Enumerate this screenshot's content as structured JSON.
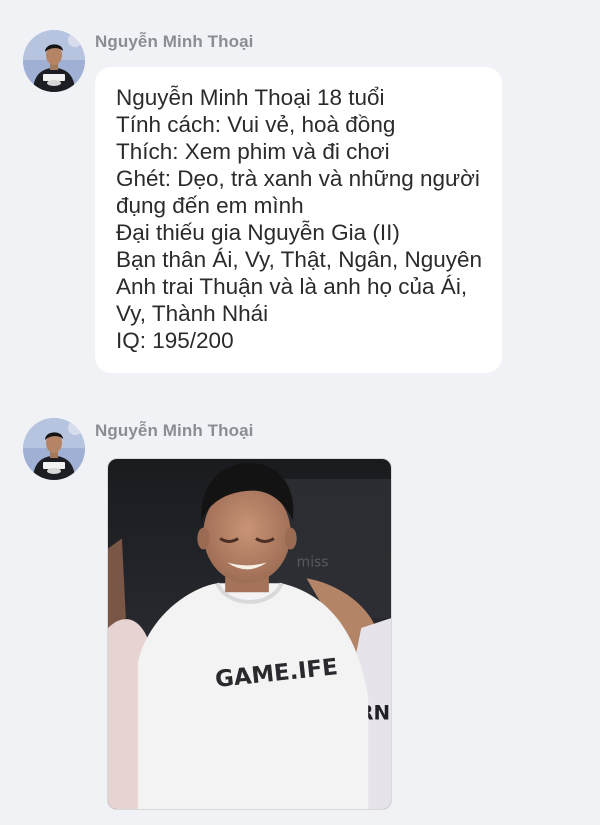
{
  "messages": [
    {
      "sender": "Nguyễn Minh Thoại",
      "avatar_icon": "user-avatar-icon",
      "lines": [
        "Nguyễn Minh Thoại 18 tuổi",
        "Tính cách: Vui vẻ, hoà đồng",
        "Thích: Xem phim và đi chơi",
        "Ghét: Dẹo, trà xanh và những người",
        "đụng đến em mình",
        "Đại thiếu gia Nguyễn Gia (II)",
        "Bạn thân Ái, Vy, Thật, Ngân, Nguyên",
        "Anh trai Thuận và là anh họ của Ái,",
        "Vy, Thành Nhái",
        "IQ: 195/200"
      ]
    },
    {
      "sender": "Nguyễn Minh Thoại",
      "avatar_icon": "user-avatar-icon",
      "photo": {
        "shirt_text": "GAME.IFE",
        "sleeve_text": "RNI",
        "bg_text": "miss"
      }
    }
  ],
  "colors": {
    "background": "#f1f2f6",
    "bubble": "#ffffff",
    "sender": "#8a8d93",
    "text": "#2b2b2b"
  }
}
